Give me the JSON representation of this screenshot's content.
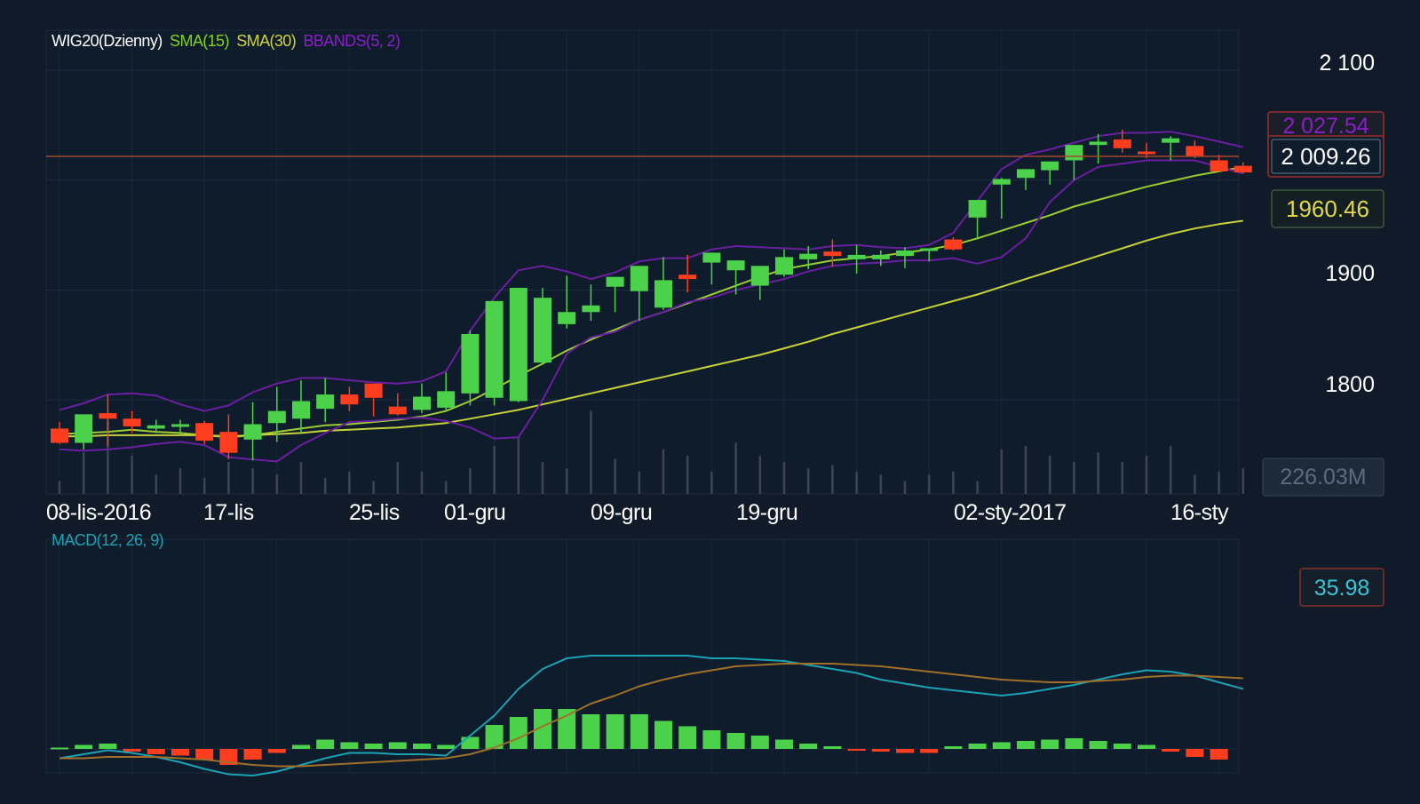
{
  "colors": {
    "background": "#101a28",
    "panel": "#0f1c2c",
    "grid": "#1f2d40",
    "up": "#4cd14a",
    "down": "#ff3d1f",
    "sma15": "#9acd32",
    "sma30": "#c8d23a",
    "bbands": "#6a1fa0",
    "macd": "#1aa3b3",
    "signal": "#a0702a",
    "price_line": "#a8442a",
    "text": "#ffffff",
    "muted": "#5d6b7e"
  },
  "price_panel": {
    "legend": {
      "symbol": "WIG20(Dzienny)",
      "sma15": "SMA(15)",
      "sma30": "SMA(30)",
      "bbands": "BBANDS(5, 2)"
    },
    "y_ticks": [
      "2 100",
      "1900",
      "1800"
    ],
    "badges": {
      "bb_upper": "2 027.54",
      "last_price": "2 009.26",
      "sma15": "1960.46",
      "volume": "226.03M"
    },
    "x_ticks": [
      "08-lis-2016",
      "17-lis",
      "25-lis",
      "01-gru",
      "09-gru",
      "19-gru",
      "02-sty-2017",
      "16-sty"
    ]
  },
  "macd_panel": {
    "legend": "MACD(12, 26, 9)",
    "badge": "35.98"
  },
  "chart_data": [
    {
      "type": "candlestick",
      "title": "WIG20(Dzienny)",
      "ylim": [
        1742,
        2120
      ],
      "x": [
        "08-lis-2016",
        "",
        "",
        "",
        "",
        "",
        "",
        "17-lis",
        "",
        "",
        "",
        "",
        "",
        "25-lis",
        "",
        "",
        "01-gru",
        "",
        "",
        "",
        "",
        "",
        "09-gru",
        "",
        "",
        "",
        "",
        "",
        "19-gru",
        "",
        "",
        "",
        "",
        "",
        "",
        "",
        "",
        "",
        "",
        "02-sty-2017",
        "",
        "",
        "",
        "",
        "",
        "",
        "",
        "",
        "16-sty",
        ""
      ],
      "open": [
        1774,
        1761,
        1788,
        1783,
        1774,
        1776,
        1779,
        1771,
        1764,
        1779,
        1783,
        1792,
        1805,
        1815,
        1794,
        1791,
        1793,
        1806,
        1802,
        1799,
        1834,
        1869,
        1880,
        1903,
        1899,
        1884,
        1914,
        1925,
        1918,
        1904,
        1914,
        1928,
        1935,
        1928,
        1928,
        1931,
        1936,
        1946,
        1966,
        1996,
        2002,
        2009,
        2018,
        2032,
        2037,
        2026,
        2034,
        2031,
        2018,
        2013
      ],
      "high": [
        1780,
        1782,
        1805,
        1790,
        1782,
        1782,
        1781,
        1787,
        1798,
        1812,
        1818,
        1820,
        1812,
        1805,
        1806,
        1815,
        1825,
        1863,
        1879,
        1895,
        1902,
        1913,
        1905,
        1908,
        1916,
        1930,
        1932,
        1931,
        1920,
        1917,
        1937,
        1940,
        1946,
        1941,
        1936,
        1939,
        1937,
        1948,
        1970,
        2002,
        2010,
        2015,
        2032,
        2042,
        2046,
        2034,
        2040,
        2036,
        2023,
        2016
      ],
      "low": [
        1760,
        1755,
        1758,
        1770,
        1770,
        1768,
        1760,
        1746,
        1745,
        1762,
        1770,
        1780,
        1790,
        1785,
        1786,
        1788,
        1790,
        1795,
        1795,
        1798,
        1832,
        1865,
        1872,
        1880,
        1872,
        1882,
        1898,
        1905,
        1896,
        1891,
        1912,
        1919,
        1921,
        1915,
        1922,
        1920,
        1926,
        1936,
        1946,
        1965,
        1991,
        1996,
        2000,
        2015,
        2025,
        2020,
        2018,
        2020,
        2008,
        2006
      ],
      "close": [
        1761,
        1787,
        1783,
        1776,
        1777,
        1778,
        1763,
        1752,
        1778,
        1790,
        1799,
        1805,
        1796,
        1802,
        1787,
        1803,
        1808,
        1860,
        1890,
        1902,
        1893,
        1880,
        1886,
        1912,
        1922,
        1909,
        1910,
        1934,
        1927,
        1922,
        1930,
        1933,
        1931,
        1932,
        1932,
        1936,
        1938,
        1937,
        1982,
        2001,
        2010,
        2017,
        2032,
        2035,
        2029,
        2024,
        2038,
        2022,
        2008,
        2007
      ],
      "volume_m": [
        20,
        65,
        115,
        60,
        30,
        40,
        25,
        50,
        40,
        30,
        50,
        25,
        35,
        20,
        50,
        35,
        20,
        40,
        75,
        90,
        50,
        40,
        130,
        55,
        35,
        70,
        60,
        35,
        80,
        60,
        50,
        40,
        45,
        35,
        30,
        20,
        30,
        35,
        20,
        70,
        75,
        60,
        50,
        65,
        50,
        60,
        75,
        30,
        35,
        40
      ]
    },
    {
      "type": "line",
      "title": "SMA(15) SMA(30) BBANDS(5, 2)",
      "ylim": [
        1742,
        2120
      ],
      "series": [
        {
          "name": "SMA(15)",
          "x_start": 0,
          "values": [
            1769,
            1770,
            1771,
            1773,
            1771,
            1770,
            1768,
            1766,
            1768,
            1771,
            1774,
            1777,
            1778,
            1780,
            1782,
            1785,
            1790,
            1799,
            1810,
            1822,
            1833,
            1845,
            1855,
            1864,
            1873,
            1880,
            1888,
            1896,
            1904,
            1912,
            1919,
            1923,
            1927,
            1929,
            1931,
            1934,
            1937,
            1941,
            1947,
            1954,
            1961,
            1968,
            1976,
            1982,
            1988,
            1994,
            1999,
            2004,
            2008,
            2012
          ]
        },
        {
          "name": "SMA(30)",
          "x_start": 0,
          "values": [
            1767,
            1767,
            1768,
            1768,
            1768,
            1768,
            1768,
            1767,
            1768,
            1769,
            1770,
            1772,
            1773,
            1774,
            1775,
            1777,
            1779,
            1783,
            1787,
            1791,
            1796,
            1801,
            1806,
            1811,
            1816,
            1821,
            1826,
            1831,
            1836,
            1841,
            1847,
            1853,
            1860,
            1866,
            1872,
            1878,
            1884,
            1890,
            1896,
            1903,
            1910,
            1917,
            1924,
            1931,
            1938,
            1945,
            1951,
            1956,
            1960,
            1963
          ]
        },
        {
          "name": "BBANDS(5, 2) upper",
          "x_start": 0,
          "values": [
            1791,
            1797,
            1805,
            1806,
            1804,
            1796,
            1790,
            1795,
            1807,
            1815,
            1820,
            1820,
            1818,
            1816,
            1815,
            1817,
            1826,
            1863,
            1893,
            1918,
            1922,
            1917,
            1910,
            1916,
            1926,
            1929,
            1929,
            1937,
            1940,
            1939,
            1938,
            1937,
            1940,
            1941,
            1939,
            1938,
            1941,
            1952,
            1981,
            2010,
            2023,
            2028,
            2034,
            2040,
            2043,
            2043,
            2044,
            2040,
            2035,
            2030
          ]
        },
        {
          "name": "BBANDS(5, 2) lower",
          "x_start": 0,
          "values": [
            1755,
            1754,
            1755,
            1757,
            1760,
            1762,
            1759,
            1748,
            1746,
            1744,
            1759,
            1770,
            1780,
            1781,
            1783,
            1784,
            1781,
            1775,
            1765,
            1766,
            1800,
            1842,
            1857,
            1862,
            1873,
            1880,
            1889,
            1893,
            1900,
            1905,
            1910,
            1917,
            1922,
            1924,
            1925,
            1927,
            1927,
            1929,
            1924,
            1930,
            1947,
            1980,
            2000,
            2012,
            2015,
            2018,
            2018,
            2018,
            2012,
            2006
          ]
        }
      ]
    },
    {
      "type": "bar",
      "title": "MACD(12, 26, 9)",
      "ylim": [
        -60,
        80
      ],
      "series": [
        {
          "name": "MACD(12, 26, 9)",
          "values": [
            -7,
            -4,
            -1,
            -3,
            -6,
            -10,
            -15,
            -19,
            -20,
            -17,
            -12,
            -7,
            -3,
            -3,
            -4,
            -4,
            -5,
            10,
            25,
            45,
            60,
            68,
            70,
            70,
            70,
            70,
            70,
            68,
            68,
            67,
            66,
            63,
            60,
            57,
            52,
            49,
            46,
            44,
            42,
            40,
            42,
            45,
            48,
            52,
            56,
            59,
            58,
            55,
            50,
            45
          ]
        },
        {
          "name": "signal",
          "values": [
            -7,
            -7,
            -6,
            -6,
            -6,
            -7,
            -8,
            -10,
            -12,
            -13,
            -13,
            -12,
            -11,
            -10,
            -9,
            -8,
            -7,
            -4,
            1,
            8,
            17,
            25,
            34,
            40,
            47,
            52,
            56,
            59,
            62,
            63,
            64,
            64,
            64,
            63,
            62,
            60,
            58,
            56,
            54,
            52,
            51,
            50,
            50,
            51,
            52,
            54,
            55,
            55,
            54,
            53
          ]
        },
        {
          "name": "histogram",
          "values": [
            1,
            3,
            4,
            -2,
            -4,
            -5,
            -8,
            -12,
            -8,
            -3,
            3,
            7,
            5,
            4,
            5,
            4,
            3,
            9,
            18,
            24,
            30,
            30,
            26,
            26,
            26,
            21,
            17,
            14,
            12,
            10,
            7,
            4,
            2,
            -1,
            -2,
            -3,
            -3,
            2,
            4,
            5,
            6,
            7,
            8,
            6,
            4,
            3,
            -2,
            -6,
            -8
          ]
        }
      ]
    }
  ]
}
